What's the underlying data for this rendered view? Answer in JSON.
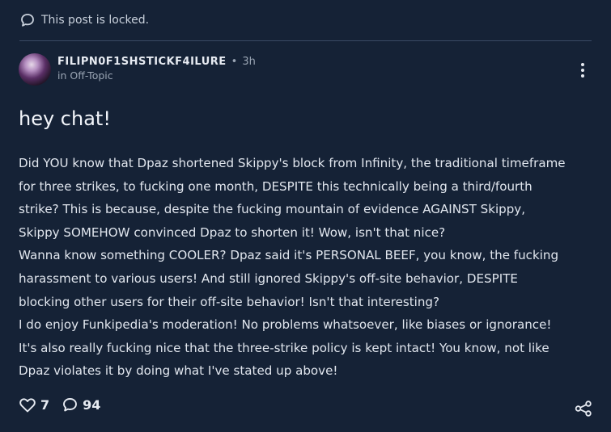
{
  "lock_notice": {
    "text": "This post is locked.",
    "icon": "speech-bubble-icon"
  },
  "post": {
    "author": "FILIPN0F1SHSTICKF4ILURE",
    "separator": "•",
    "time": "3h",
    "category": "in Off-Topic",
    "title": "hey chat!",
    "body_lines": [
      "Did YOU know that Dpaz shortened Skippy's block from Infinity, the traditional timeframe",
      "for three strikes, to fucking one month, DESPITE this technically being a third/fourth",
      "strike? This is because, despite the fucking mountain of evidence AGAINST Skippy,",
      "Skippy SOMEHOW convinced Dpaz to shorten it! Wow, isn't that nice?",
      "Wanna know something COOLER? Dpaz said it's PERSONAL BEEF, you know, the fucking",
      "harassment to various users! And still ignored Skippy's off-site behavior, DESPITE",
      "blocking other users for their off-site behavior! Isn't that interesting?",
      "I do enjoy Funkipedia's moderation! No problems whatsoever, like biases or ignorance!",
      "It's also really fucking nice that the three-strike policy is kept intact! You know, not like",
      "Dpaz violates it by doing what I've stated up above!"
    ],
    "likes": "7",
    "comments": "94"
  },
  "colors": {
    "background": "#152236",
    "text": "#e7ebf2",
    "muted": "#9aa5b4",
    "divider": "#3a4a63"
  }
}
